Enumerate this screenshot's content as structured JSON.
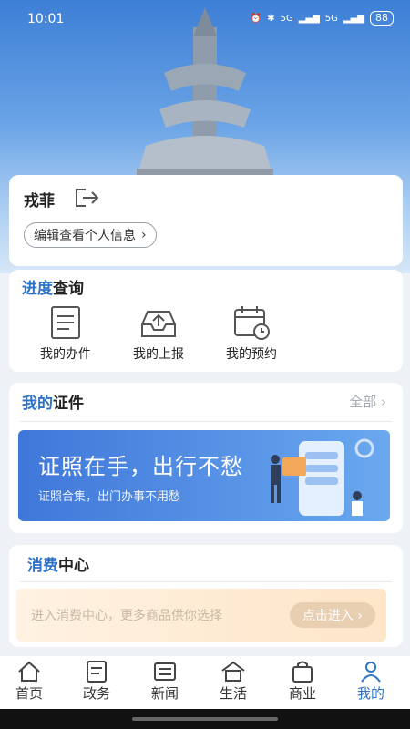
{
  "status": {
    "time": "10:01",
    "net1": "5G",
    "net2": "5G",
    "battery": "88"
  },
  "profile": {
    "name": "戎菲",
    "edit_label": "编辑查看个人信息"
  },
  "progress": {
    "title_blue": "进度",
    "title_rest": "查询",
    "items": [
      {
        "label": "我的办件"
      },
      {
        "label": "我的上报"
      },
      {
        "label": "我的预约"
      }
    ]
  },
  "certificates": {
    "title_blue": "我的",
    "title_rest": "证件",
    "more": "全部",
    "banner_title": "证照在手，出行不愁",
    "banner_sub": "证照合集，出门办事不用愁"
  },
  "consume": {
    "title_blue": "消费",
    "title_rest": "中心",
    "desc": "进入消费中心，更多商品供你选择",
    "enter": "点击进入"
  },
  "tabs": [
    {
      "label": "首页"
    },
    {
      "label": "政务"
    },
    {
      "label": "新闻"
    },
    {
      "label": "生活"
    },
    {
      "label": "商业"
    },
    {
      "label": "我的"
    }
  ],
  "colors": {
    "accent": "#2e72c7"
  }
}
